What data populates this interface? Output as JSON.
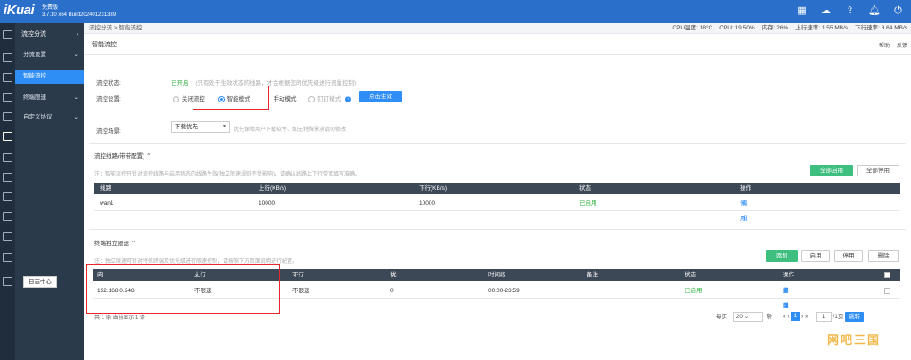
{
  "app": {
    "logo": "iKuai",
    "edition": "免费版",
    "build": "3.7.10 x64 Build202401231339"
  },
  "topbar_icons": [
    "grid-icon",
    "cloud-icon",
    "upgrade-icon",
    "bell-icon",
    "logout-icon"
  ],
  "sidebar": {
    "group_main": "流控分流",
    "groups": [
      {
        "label": "分流设置",
        "expanded": false
      },
      {
        "label": "智能流控",
        "active": true
      },
      {
        "label": "终端限速",
        "expanded": false
      },
      {
        "label": "自定义协议",
        "expanded": false
      }
    ],
    "tooltip": "日志中心"
  },
  "statusbar": {
    "breadcrumb": "流控分流 > 智能流控",
    "cpu_temp": "CPU温度: 18°C",
    "cpu": "CPU: 19.50%",
    "mem": "内存: 26%",
    "up": "上行速率: 1.55 MB/s",
    "down": "下行速率: 8.64 MB/s"
  },
  "page": {
    "title": "智能流控",
    "links": [
      "帮助",
      "反馈"
    ]
  },
  "form": {
    "status_label": "流控状态:",
    "status_value": "已开启",
    "status_hint": "(只有处于生效状态的线路，才会根据您的优先级进行流量控制)",
    "mode_label": "流控设置:",
    "modes": [
      {
        "label": "关闭流控",
        "checked": false
      },
      {
        "label": "智能模式",
        "checked": true
      },
      {
        "label": "手动模式",
        "checked": false
      },
      {
        "label": "钉钉模式",
        "checked": false,
        "disabled": true
      }
    ],
    "apply_button": "点击生效",
    "scene_label": "流控场景:",
    "scene_value": "下载优先",
    "scene_hint": "优先保障用户下载软件、如无特殊需求请勿修改"
  },
  "lines": {
    "section_title": "流控线路(带带配置)",
    "note": "注：智能流控只针对流控线路与启用状态的线路生效(独立限速规则不受影响)，请确认线路上下行带宽填写准确。",
    "btn_enable_all": "全部启用",
    "btn_disable_all": "全部停用",
    "headers": [
      "线路",
      "上行(KB/s)",
      "下行(KB/s)",
      "状态",
      "操作"
    ],
    "rows": [
      {
        "line": "wan1",
        "up": "10000",
        "down": "10000",
        "status": "已启用",
        "actions": [
          "停用",
          "编辑"
        ]
      }
    ]
  },
  "limits": {
    "section_title": "终端独立限速",
    "note": "注：独立限速可针对特殊终端及优先级进行限速控制，请按照下方页面说明进行配置。",
    "btn_add": "添加",
    "btn_enable": "启用",
    "btn_disable": "停用",
    "btn_delete": "删除",
    "headers": [
      "内网IP",
      "上行(KB/s)",
      "下行(KB/s)",
      "优先级",
      "时间段",
      "备注",
      "状态",
      "操作"
    ],
    "rows": [
      {
        "ip": "192.168.0.248",
        "up": "不限速",
        "down": "不限速",
        "priority": "0",
        "time": "00:00-23:59",
        "remark": "",
        "status": "已启用",
        "actions": [
          "编辑",
          "复制",
          "停用",
          "删除"
        ]
      }
    ],
    "footer": "共 1 条 当前显示 1 条"
  },
  "pager": {
    "per_page_label": "每页",
    "per_page": "20",
    "unit": "条",
    "current": "1",
    "goto_value": "1",
    "total": "/1页",
    "jump": "跳转"
  },
  "watermark": "网吧三国",
  "colors": {
    "topbar": "#2a6fc9",
    "sidebar": "#2b3a4a",
    "active": "#2f8ef5",
    "green": "#3fbf7f",
    "table_head": "#3d4857",
    "highlight": "#e8262e"
  }
}
